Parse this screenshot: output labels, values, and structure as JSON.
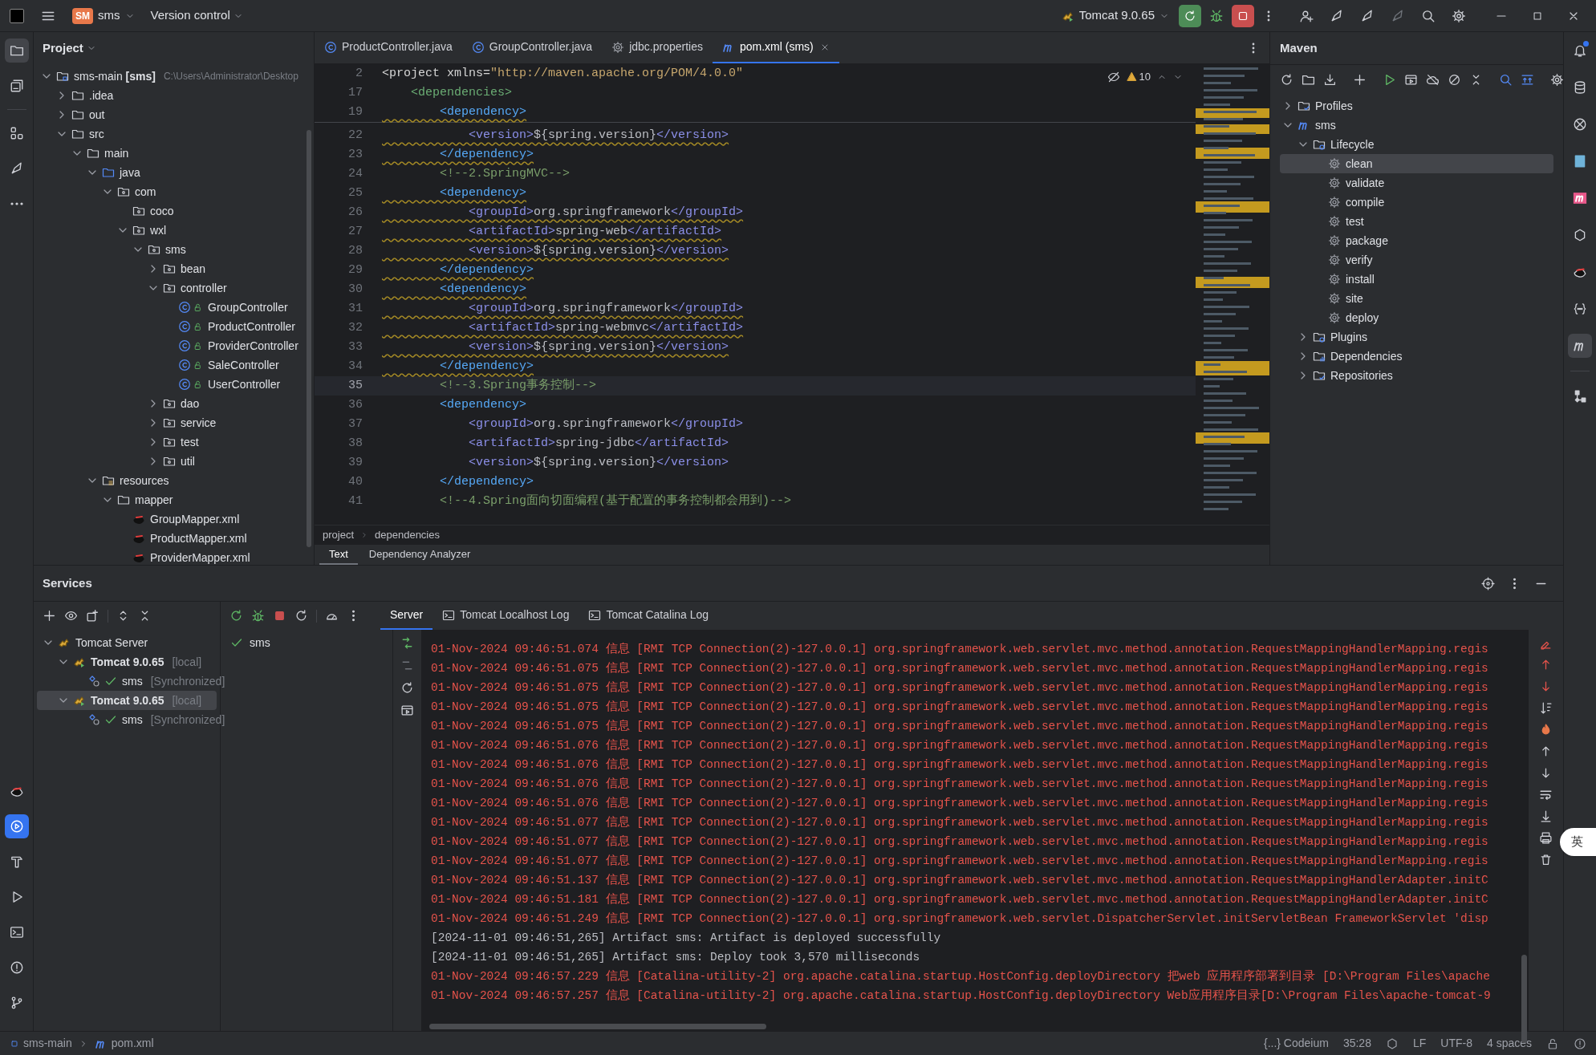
{
  "title_bar": {
    "project_badge": "SM",
    "project": "sms",
    "vcs": "Version control",
    "run_config": "Tomcat 9.0.65"
  },
  "project_panel": {
    "title": "Project",
    "tree": [
      {
        "label": "sms-main **[sms]**",
        "hint": "C:\\Users\\Administrator\\Desktop",
        "kind": "module",
        "expanded": true,
        "children": [
          {
            "label": ".idea",
            "kind": "folder",
            "expanded": false
          },
          {
            "label": "out",
            "kind": "folder",
            "expanded": false
          },
          {
            "label": "src",
            "kind": "folder",
            "expanded": true,
            "children": [
              {
                "label": "main",
                "kind": "folder",
                "expanded": true,
                "children": [
                  {
                    "label": "java",
                    "kind": "source-root",
                    "expanded": true,
                    "children": [
                      {
                        "label": "com",
                        "kind": "package",
                        "expanded": true,
                        "children": [
                          {
                            "label": "coco",
                            "kind": "package"
                          },
                          {
                            "label": "wxl",
                            "kind": "package",
                            "expanded": true,
                            "children": [
                              {
                                "label": "sms",
                                "kind": "package",
                                "expanded": true,
                                "children": [
                                  {
                                    "label": "bean",
                                    "kind": "package",
                                    "expanded": false
                                  },
                                  {
                                    "label": "controller",
                                    "kind": "package",
                                    "expanded": true,
                                    "children": [
                                      {
                                        "label": "GroupController",
                                        "kind": "class"
                                      },
                                      {
                                        "label": "ProductController",
                                        "kind": "class"
                                      },
                                      {
                                        "label": "ProviderController",
                                        "kind": "class"
                                      },
                                      {
                                        "label": "SaleController",
                                        "kind": "class"
                                      },
                                      {
                                        "label": "UserController",
                                        "kind": "class"
                                      }
                                    ]
                                  },
                                  {
                                    "label": "dao",
                                    "kind": "package",
                                    "expanded": false
                                  },
                                  {
                                    "label": "service",
                                    "kind": "package",
                                    "expanded": false
                                  },
                                  {
                                    "label": "test",
                                    "kind": "package",
                                    "expanded": false
                                  },
                                  {
                                    "label": "util",
                                    "kind": "package",
                                    "expanded": false
                                  }
                                ]
                              }
                            ]
                          }
                        ]
                      }
                    ]
                  },
                  {
                    "label": "resources",
                    "kind": "resource-root",
                    "expanded": true,
                    "children": [
                      {
                        "label": "mapper",
                        "kind": "folder",
                        "expanded": true,
                        "children": [
                          {
                            "label": "GroupMapper.xml",
                            "kind": "mapper-xml"
                          },
                          {
                            "label": "ProductMapper.xml",
                            "kind": "mapper-xml"
                          },
                          {
                            "label": "ProviderMapper.xml",
                            "kind": "mapper-xml"
                          }
                        ]
                      }
                    ]
                  }
                ]
              }
            ]
          }
        ]
      }
    ]
  },
  "editor": {
    "tabs": [
      {
        "label": "ProductController.java",
        "kind": "class",
        "selected": false
      },
      {
        "label": "GroupController.java",
        "kind": "class",
        "selected": false
      },
      {
        "label": "jdbc.properties",
        "kind": "properties",
        "selected": false
      },
      {
        "label": "pom.xml (sms)",
        "kind": "maven",
        "selected": true
      }
    ],
    "warning_count": "10",
    "sticky_lines": [
      {
        "number": "2",
        "code": "<project xmlns=\"http://maven.apache.org/POM/4.0.0\"",
        "warning": false
      },
      {
        "number": "17",
        "code": "    <dependencies>",
        "warning": false
      },
      {
        "number": "19",
        "code": "        <dependency>",
        "warning": true
      }
    ],
    "lines": [
      {
        "number": "22",
        "code": "            <version>${spring.version}</version>",
        "warning": true,
        "current": false
      },
      {
        "number": "23",
        "code": "        </dependency>",
        "warning": true,
        "current": false
      },
      {
        "number": "24",
        "code": "        <!--2.SpringMVC-->",
        "warning": false,
        "current": false
      },
      {
        "number": "25",
        "code": "        <dependency>",
        "warning": true,
        "current": false
      },
      {
        "number": "26",
        "code": "            <groupId>org.springframework</groupId>",
        "warning": true,
        "current": false
      },
      {
        "number": "27",
        "code": "            <artifactId>spring-web</artifactId>",
        "warning": true,
        "current": false
      },
      {
        "number": "28",
        "code": "            <version>${spring.version}</version>",
        "warning": true,
        "current": false
      },
      {
        "number": "29",
        "code": "        </dependency>",
        "warning": true,
        "current": false
      },
      {
        "number": "30",
        "code": "        <dependency>",
        "warning": true,
        "current": false
      },
      {
        "number": "31",
        "code": "            <groupId>org.springframework</groupId>",
        "warning": true,
        "current": false
      },
      {
        "number": "32",
        "code": "            <artifactId>spring-webmvc</artifactId>",
        "warning": true,
        "current": false
      },
      {
        "number": "33",
        "code": "            <version>${spring.version}</version>",
        "warning": true,
        "current": false
      },
      {
        "number": "34",
        "code": "        </dependency>",
        "warning": true,
        "current": false
      },
      {
        "number": "35",
        "code": "        <!--3.Spring事务控制-->",
        "warning": false,
        "current": true
      },
      {
        "number": "36",
        "code": "        <dependency>",
        "warning": false,
        "current": false
      },
      {
        "number": "37",
        "code": "            <groupId>org.springframework</groupId>",
        "warning": false,
        "current": false
      },
      {
        "number": "38",
        "code": "            <artifactId>spring-jdbc</artifactId>",
        "warning": false,
        "current": false
      },
      {
        "number": "39",
        "code": "            <version>${spring.version}</version>",
        "warning": false,
        "current": false
      },
      {
        "number": "40",
        "code": "        </dependency>",
        "warning": false,
        "current": false
      },
      {
        "number": "41",
        "code": "        <!--4.Spring面向切面编程(基于配置的事务控制都会用到)-->",
        "warning": false,
        "current": false
      }
    ],
    "breadcrumb": [
      "project",
      "dependencies"
    ],
    "bottom_tabs": [
      {
        "label": "Text",
        "selected": true
      },
      {
        "label": "Dependency Analyzer",
        "selected": false
      }
    ]
  },
  "maven": {
    "title": "Maven",
    "tree": [
      {
        "label": "Profiles",
        "kind": "profiles",
        "expanded": false
      },
      {
        "label": "sms",
        "kind": "maven",
        "expanded": true,
        "children": [
          {
            "label": "Lifecycle",
            "kind": "lifecycle",
            "expanded": true,
            "children": [
              {
                "label": "clean",
                "kind": "goal",
                "selected": true
              },
              {
                "label": "validate",
                "kind": "goal",
                "selected": false
              },
              {
                "label": "compile",
                "kind": "goal",
                "selected": false
              },
              {
                "label": "test",
                "kind": "goal",
                "selected": false
              },
              {
                "label": "package",
                "kind": "goal",
                "selected": false
              },
              {
                "label": "verify",
                "kind": "goal",
                "selected": false
              },
              {
                "label": "install",
                "kind": "goal",
                "selected": false
              },
              {
                "label": "site",
                "kind": "goal",
                "selected": false
              },
              {
                "label": "deploy",
                "kind": "goal",
                "selected": false
              }
            ]
          },
          {
            "label": "Plugins",
            "kind": "lifecycle",
            "expanded": false
          },
          {
            "label": "Dependencies",
            "kind": "dependencies",
            "expanded": false
          },
          {
            "label": "Repositories",
            "kind": "profiles",
            "expanded": false
          }
        ]
      }
    ]
  },
  "services": {
    "title": "Services",
    "tree": [
      {
        "label": "Tomcat Server",
        "kind": "tomcat-group",
        "expanded": true,
        "selected": false,
        "children": [
          {
            "label": "Tomcat 9.0.65",
            "hint": "[local]",
            "kind": "tomcat",
            "expanded": true,
            "selected": false,
            "children": [
              {
                "label": "sms",
                "hint": "[Synchronized]",
                "kind": "artifact",
                "selected": false
              }
            ]
          },
          {
            "label": "Tomcat 9.0.65",
            "hint": "[local]",
            "kind": "tomcat",
            "expanded": true,
            "selected": true,
            "children": [
              {
                "label": "sms",
                "hint": "[Synchronized]",
                "kind": "artifact",
                "selected": false
              }
            ]
          }
        ]
      }
    ],
    "tabs": [
      {
        "label": "Server",
        "kind": "plain",
        "selected": true
      },
      {
        "label": "Tomcat Localhost Log",
        "kind": "log",
        "selected": false
      },
      {
        "label": "Tomcat Catalina Log",
        "kind": "log",
        "selected": false
      }
    ],
    "deployments": [
      "sms"
    ],
    "log": [
      {
        "text": "01-Nov-2024 09:46:51.074 信息 [RMI TCP Connection(2)-127.0.0.1] org.springframework.web.servlet.mvc.method.annotation.RequestMappingHandlerMapping.regis",
        "kind": "info"
      },
      {
        "text": "01-Nov-2024 09:46:51.075 信息 [RMI TCP Connection(2)-127.0.0.1] org.springframework.web.servlet.mvc.method.annotation.RequestMappingHandlerMapping.regis",
        "kind": "info"
      },
      {
        "text": "01-Nov-2024 09:46:51.075 信息 [RMI TCP Connection(2)-127.0.0.1] org.springframework.web.servlet.mvc.method.annotation.RequestMappingHandlerMapping.regis",
        "kind": "info"
      },
      {
        "text": "01-Nov-2024 09:46:51.075 信息 [RMI TCP Connection(2)-127.0.0.1] org.springframework.web.servlet.mvc.method.annotation.RequestMappingHandlerMapping.regis",
        "kind": "info"
      },
      {
        "text": "01-Nov-2024 09:46:51.075 信息 [RMI TCP Connection(2)-127.0.0.1] org.springframework.web.servlet.mvc.method.annotation.RequestMappingHandlerMapping.regis",
        "kind": "info"
      },
      {
        "text": "01-Nov-2024 09:46:51.076 信息 [RMI TCP Connection(2)-127.0.0.1] org.springframework.web.servlet.mvc.method.annotation.RequestMappingHandlerMapping.regis",
        "kind": "info"
      },
      {
        "text": "01-Nov-2024 09:46:51.076 信息 [RMI TCP Connection(2)-127.0.0.1] org.springframework.web.servlet.mvc.method.annotation.RequestMappingHandlerMapping.regis",
        "kind": "info"
      },
      {
        "text": "01-Nov-2024 09:46:51.076 信息 [RMI TCP Connection(2)-127.0.0.1] org.springframework.web.servlet.mvc.method.annotation.RequestMappingHandlerMapping.regis",
        "kind": "info"
      },
      {
        "text": "01-Nov-2024 09:46:51.076 信息 [RMI TCP Connection(2)-127.0.0.1] org.springframework.web.servlet.mvc.method.annotation.RequestMappingHandlerMapping.regis",
        "kind": "info"
      },
      {
        "text": "01-Nov-2024 09:46:51.077 信息 [RMI TCP Connection(2)-127.0.0.1] org.springframework.web.servlet.mvc.method.annotation.RequestMappingHandlerMapping.regis",
        "kind": "info"
      },
      {
        "text": "01-Nov-2024 09:46:51.077 信息 [RMI TCP Connection(2)-127.0.0.1] org.springframework.web.servlet.mvc.method.annotation.RequestMappingHandlerMapping.regis",
        "kind": "info"
      },
      {
        "text": "01-Nov-2024 09:46:51.077 信息 [RMI TCP Connection(2)-127.0.0.1] org.springframework.web.servlet.mvc.method.annotation.RequestMappingHandlerMapping.regis",
        "kind": "info"
      },
      {
        "text": "01-Nov-2024 09:46:51.137 信息 [RMI TCP Connection(2)-127.0.0.1] org.springframework.web.servlet.mvc.method.annotation.RequestMappingHandlerAdapter.initC",
        "kind": "info"
      },
      {
        "text": "01-Nov-2024 09:46:51.181 信息 [RMI TCP Connection(2)-127.0.0.1] org.springframework.web.servlet.mvc.method.annotation.RequestMappingHandlerAdapter.initC",
        "kind": "info"
      },
      {
        "text": "01-Nov-2024 09:46:51.249 信息 [RMI TCP Connection(2)-127.0.0.1] org.springframework.web.servlet.DispatcherServlet.initServletBean FrameworkServlet 'disp",
        "kind": "info"
      },
      {
        "text": "[2024-11-01 09:46:51,265] Artifact sms: Artifact is deployed successfully",
        "kind": "plain"
      },
      {
        "text": "[2024-11-01 09:46:51,265] Artifact sms: Deploy took 3,570 milliseconds",
        "kind": "plain"
      },
      {
        "text": "01-Nov-2024 09:46:57.229 信息 [Catalina-utility-2] org.apache.catalina.startup.HostConfig.deployDirectory 把web 应用程序部署到目录 [D:\\Program Files\\apache",
        "kind": "info"
      },
      {
        "text": "01-Nov-2024 09:46:57.257 信息 [Catalina-utility-2] org.apache.catalina.startup.HostConfig.deployDirectory Web应用程序目录[D:\\Program Files\\apache-tomcat-9",
        "kind": "info"
      }
    ]
  },
  "status_bar": {
    "breadcrumb": [
      "sms-main",
      "pom.xml"
    ],
    "codeium": "{...} Codeium",
    "position": "35:28",
    "line_ending": "LF",
    "encoding": "UTF-8",
    "indent": "4 spaces"
  },
  "ime_indicator": "英"
}
